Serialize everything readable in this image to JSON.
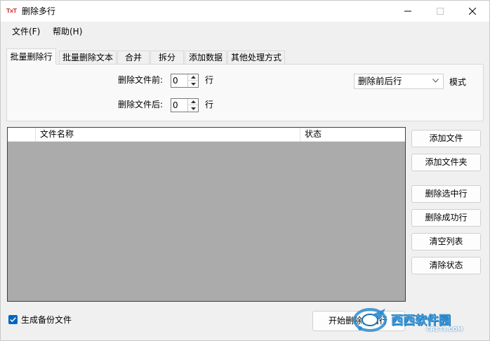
{
  "window": {
    "title": "删除多行",
    "app_icon_text": "TxT"
  },
  "menu": {
    "file": "文件(F)",
    "help": "帮助(H)"
  },
  "tabs": [
    {
      "label": "批量删除行",
      "active": true
    },
    {
      "label": "批量删除文本",
      "active": false
    },
    {
      "label": "合并",
      "active": false
    },
    {
      "label": "拆分",
      "active": false
    },
    {
      "label": "添加数据",
      "active": false
    },
    {
      "label": "其他处理方式",
      "active": false
    }
  ],
  "options": {
    "before_label": "删除文件前:",
    "before_value": "0",
    "after_label": "删除文件后:",
    "after_value": "0",
    "unit": "行",
    "mode_value": "删除前后行",
    "mode_label": "模式"
  },
  "list": {
    "columns": [
      "",
      "文件名称",
      "状态"
    ],
    "rows": []
  },
  "buttons": {
    "add_file": "添加文件",
    "add_folder": "添加文件夹",
    "delete_selected": "删除选中行",
    "delete_success": "删除成功行",
    "clear_list": "清空列表",
    "clear_status": "清除状态"
  },
  "backup": {
    "label": "生成备份文件",
    "checked": true
  },
  "start_button": "开始删除前后行",
  "watermark": {
    "text": "西西软件园",
    "sub": "CR173.COM"
  },
  "colors": {
    "accent": "#0067c0",
    "list_background": "#ababab",
    "watermark": "#2a8bd0"
  }
}
